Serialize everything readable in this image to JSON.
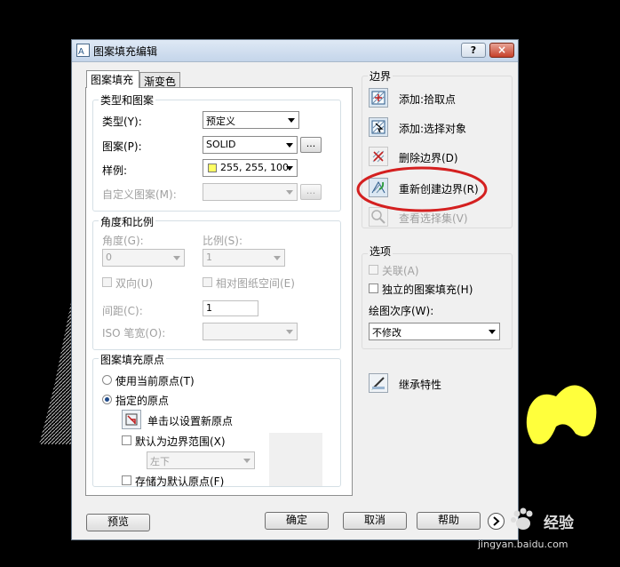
{
  "dialog": {
    "title": "图案填充编辑",
    "help_label": "?",
    "close_label": "×"
  },
  "tabs": [
    "图案填充",
    "渐变色"
  ],
  "type_pattern": {
    "group_title": "类型和图案",
    "type_label": "类型(Y):",
    "type_value": "预定义",
    "pattern_label": "图案(P):",
    "pattern_value": "SOLID",
    "sample_label": "样例:",
    "sample_value": "255, 255, 100",
    "sample_color": "#ffff64",
    "custom_label": "自定义图案(M):",
    "browse_label": "..."
  },
  "angle_scale": {
    "group_title": "角度和比例",
    "angle_label": "角度(G):",
    "angle_value": "0",
    "scale_label": "比例(S):",
    "scale_value": "1",
    "double_label": "双向(U)",
    "relative_label": "相对图纸空间(E)",
    "spacing_label": "间距(C):",
    "spacing_value": "1",
    "iso_label": "ISO 笔宽(O):"
  },
  "origin": {
    "group_title": "图案填充原点",
    "use_current_label": "使用当前原点(T)",
    "specified_label": "指定的原点",
    "click_set_label": "单击以设置新原点",
    "default_extent_label": "默认为边界范围(X)",
    "extent_value": "左下",
    "store_default_label": "存储为默认原点(F)"
  },
  "boundaries": {
    "title": "边界",
    "add_pick_label": "添加:拾取点",
    "add_select_label": "添加:选择对象",
    "remove_label": "删除边界(D)",
    "recreate_label": "重新创建边界(R)",
    "view_label": "查看选择集(V)"
  },
  "options": {
    "title": "选项",
    "associative_label": "关联(A)",
    "separate_label": "独立的图案填充(H)",
    "draw_order_label": "绘图次序(W):",
    "draw_order_value": "不修改"
  },
  "inherit_label": "继承特性",
  "footer": {
    "preview_label": "预览",
    "ok_label": "确定",
    "cancel_label": "取消",
    "help_label": "帮助"
  },
  "watermark": {
    "brand": "经验",
    "url": "jingyan.baidu.com"
  },
  "colors": {
    "highlight_ellipse": "#d42020",
    "yellow_scribble": "#ffff3c"
  }
}
